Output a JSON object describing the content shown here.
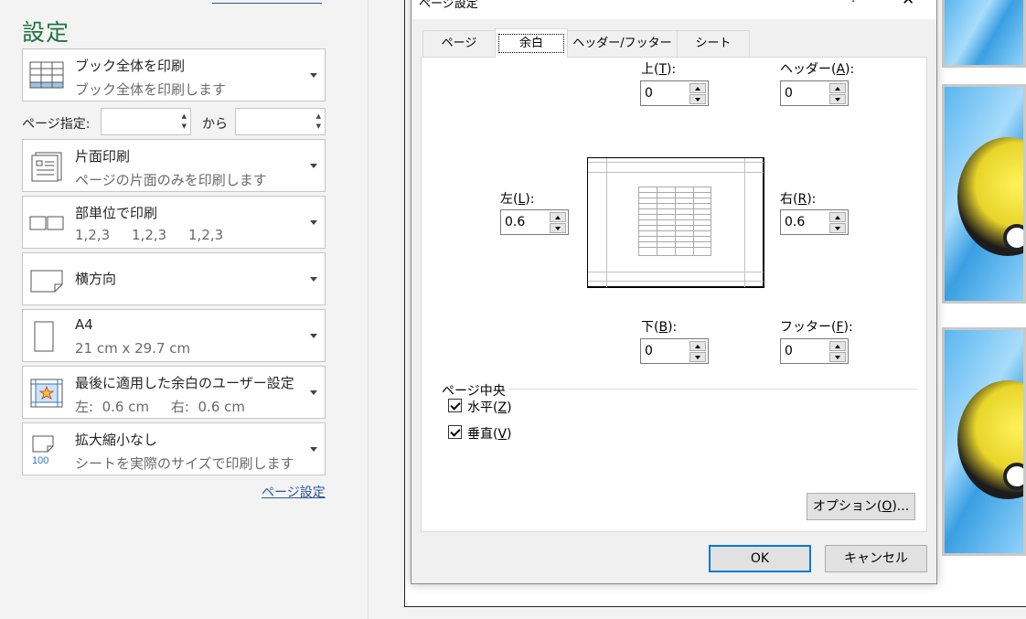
{
  "left_panel": {
    "heading": "設定",
    "options": [
      {
        "title": "ブック全体を印刷",
        "subtitle": "ブック全体を印刷します",
        "icon": "workbook-grid-icon"
      },
      {
        "title": "片面印刷",
        "subtitle": "ページの片面のみを印刷します",
        "icon": "one-sided-page-icon"
      },
      {
        "title": "部単位で印刷",
        "subtitle": "1,2,3     1,2,3     1,2,3",
        "icon": "collated-icon"
      },
      {
        "title": "横方向",
        "subtitle": "",
        "icon": "landscape-orientation-icon"
      },
      {
        "title": "A4",
        "subtitle": "21 cm x 29.7 cm",
        "icon": "paper-size-icon"
      },
      {
        "title": "最後に適用した余白のユーザー設定",
        "subtitle": "左:  0.6 cm     右:  0.6 cm",
        "icon": "custom-margins-icon"
      },
      {
        "title": "拡大縮小なし",
        "subtitle": "シートを実際のサイズで印刷します",
        "icon": "no-scaling-100-icon"
      }
    ],
    "pages": {
      "label": "ページ指定:",
      "from_value": "",
      "to_label": "から",
      "to_value": ""
    },
    "page_setup_link": "ページ設定",
    "no_scaling_icon_text": "100"
  },
  "dialog": {
    "title": "ページ設定",
    "help": "?",
    "close": "✕",
    "tabs": [
      "ページ",
      "余白",
      "ヘッダー/フッター",
      "シート"
    ],
    "active_tab": "余白",
    "fields": {
      "top": {
        "label_pre": "上(",
        "key": "T",
        "label_post": "):",
        "value": "0"
      },
      "header": {
        "label_pre": "ヘッダー(",
        "key": "A",
        "label_post": "):",
        "value": "0"
      },
      "left": {
        "label_pre": "左(",
        "key": "L",
        "label_post": "):",
        "value": "0.6"
      },
      "right": {
        "label_pre": "右(",
        "key": "R",
        "label_post": "):",
        "value": "0.6"
      },
      "bottom": {
        "label_pre": "下(",
        "key": "B",
        "label_post": "):",
        "value": "0"
      },
      "footer": {
        "label_pre": "フッター(",
        "key": "F",
        "label_post": "):",
        "value": "0"
      }
    },
    "center_group": {
      "label": "ページ中央",
      "horizontal": {
        "label_pre": "水平(",
        "key": "Z",
        "label_post": ")",
        "checked": true
      },
      "vertical": {
        "label_pre": "垂直(",
        "key": "V",
        "label_post": ")",
        "checked": true
      }
    },
    "options_button": {
      "label_pre": "オプション(",
      "key": "O",
      "label_post": ")..."
    },
    "ok_button": "OK",
    "cancel_button": "キャンセル"
  },
  "colors": {
    "heading_green": "#217346",
    "link_blue": "#2b579a",
    "focus_blue": "#0078d7"
  }
}
